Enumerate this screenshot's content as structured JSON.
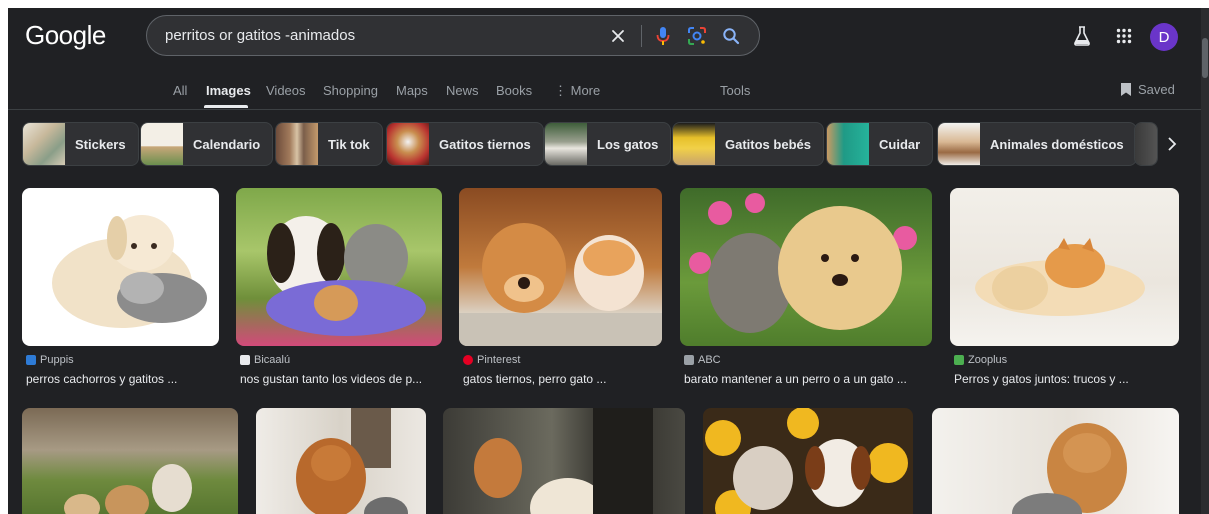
{
  "header": {
    "logo": "Google",
    "search_value": "perritos or gatitos -animados",
    "avatar_letter": "D"
  },
  "tabs": [
    {
      "label": "All"
    },
    {
      "label": "Images",
      "active": true
    },
    {
      "label": "Videos"
    },
    {
      "label": "Shopping"
    },
    {
      "label": "Maps"
    },
    {
      "label": "News"
    },
    {
      "label": "Books"
    },
    {
      "label": "⋮ More"
    },
    {
      "label": "Tools"
    }
  ],
  "saved_label": "Saved",
  "chips": [
    {
      "label": "Stickers"
    },
    {
      "label": "Calendario"
    },
    {
      "label": "Tik tok"
    },
    {
      "label": "Gatitos tiernos"
    },
    {
      "label": "Los gatos"
    },
    {
      "label": "Gatitos bebés"
    },
    {
      "label": "Cuidar"
    },
    {
      "label": "Animales domésticos"
    }
  ],
  "results": [
    {
      "source": "Puppis",
      "title": "perros cachorros y gatitos ...",
      "favicon_color": "#2e7bd6"
    },
    {
      "source": "Bicaalú",
      "title": "nos gustan tanto los videos de p...",
      "favicon_color": "#e8eaed"
    },
    {
      "source": "Pinterest",
      "title": "gatos tiernos, perro gato ...",
      "favicon_color": "#e60023"
    },
    {
      "source": "ABC",
      "title": "barato mantener a un perro o a un gato ...",
      "favicon_color": "#9aa0a6"
    },
    {
      "source": "Zooplus",
      "title": "Perros y gatos juntos: trucos y ...",
      "favicon_color": "#4caf50"
    }
  ],
  "colors": {
    "background": "#202124",
    "surface": "#303134",
    "avatar": "#6a35c9"
  }
}
